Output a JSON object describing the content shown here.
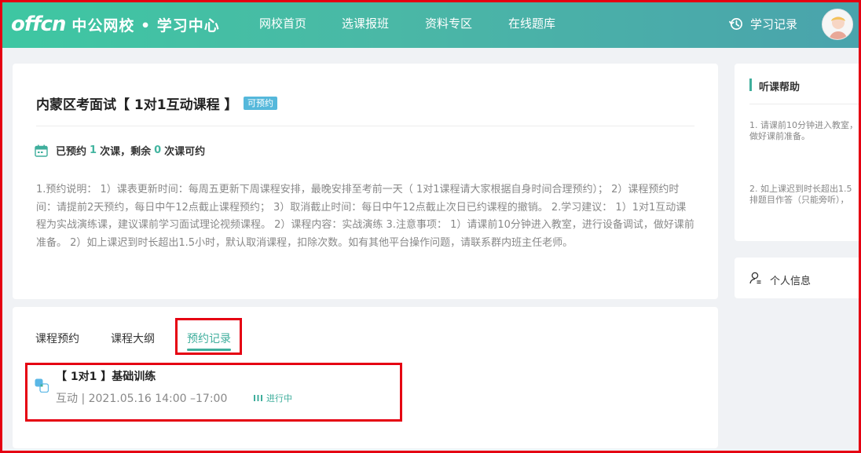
{
  "header": {
    "logo_mark": "offcn",
    "logo_text": "中公网校 • 学习中心",
    "nav": [
      "网校首页",
      "选课报班",
      "资料专区",
      "在线题库"
    ],
    "history_label": "学习记录"
  },
  "course": {
    "title": "内蒙区考面试【 1对1互动课程 】",
    "badge": "可预约",
    "stats_prefix": "已预约",
    "booked": "1",
    "stats_mid": "次课，剩余",
    "remaining": "0",
    "stats_suffix": "次课可约",
    "description": "1.预约说明： 1）课表更新时间：每周五更新下周课程安排，最晚安排至考前一天（ 1对1课程请大家根据自身时间合理预约）； 2）课程预约时间：请提前2天预约，每日中午12点截止课程预约； 3）取消截止时间：每日中午12点截止次日已约课程的撤销。 2.学习建议： 1）1对1互动课程为实战演练课，建议课前学习面试理论视频课程。 2）课程内容：实战演练 3.注意事项： 1）请课前10分钟进入教室，进行设备调试，做好课前准备。 2）如上课迟到时长超出1.5小时，默认取消课程，扣除次数。如有其他平台操作问题，请联系群内班主任老师。"
  },
  "tabs": [
    "课程预约",
    "课程大纲",
    "预约记录"
  ],
  "record": {
    "title": "【 1对1 】基础训练",
    "time": "互动 | 2021.05.16 14:00 –17:00",
    "status": "进行中"
  },
  "help": {
    "title": "听课帮助",
    "items": [
      "1. 请课前10分钟进入教室，",
      "做好课前准备。",
      "2. 如上课迟到时长超出1.5",
      "排题目作答（只能旁听），"
    ]
  },
  "info": {
    "label": "个人信息"
  },
  "colors": {
    "accent": "#3fae9c",
    "badge": "#55b8db",
    "highlight": "#e50012"
  }
}
